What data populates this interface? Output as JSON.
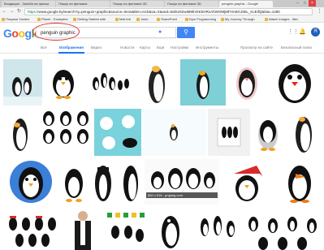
{
  "browser": {
    "tabs": [
      {
        "label": "Входящие - Захиба на фильм"
      },
      {
        "label": "Пошук на фильмах"
      },
      {
        "label": "Пошук на фильмах 3D"
      },
      {
        "label": "Пошук на фильмах 3D"
      },
      {
        "label": "penguin graphic - Google"
      }
    ],
    "url_protocol": "https://",
    "url_rest": "www.google.by/search?q=penguin+graphic&source=lnms&tbm=isch&sa=X&ved=0ahUKEwiM9bVkKbORxAhWOMjMFHA8GJSkL_KcEifQ&biw=1280",
    "bookmarks": [
      "Покупки Yandex",
      "Planet - Examples",
      "Getting Started with",
      "Mail.Inb",
      "Joker",
      "SharePoint",
      "Kipe Programming",
      "My Journey Through",
      "Attach images - lifev"
    ]
  },
  "google": {
    "logo": [
      "G",
      "o",
      "o",
      "g",
      "l",
      "e"
    ],
    "query": "penguin graphic",
    "avatar_letter": "Я"
  },
  "search_nav": {
    "items": [
      "Всё",
      "Изображения",
      "Видео",
      "Новости",
      "Карты",
      "Ещё",
      "Настройки",
      "Инструменты"
    ],
    "right": [
      "Просмотр на сайте",
      "Безопасный поиск"
    ]
  },
  "results": {
    "bottom_caption": "800 x 516 - pngimg.com"
  }
}
